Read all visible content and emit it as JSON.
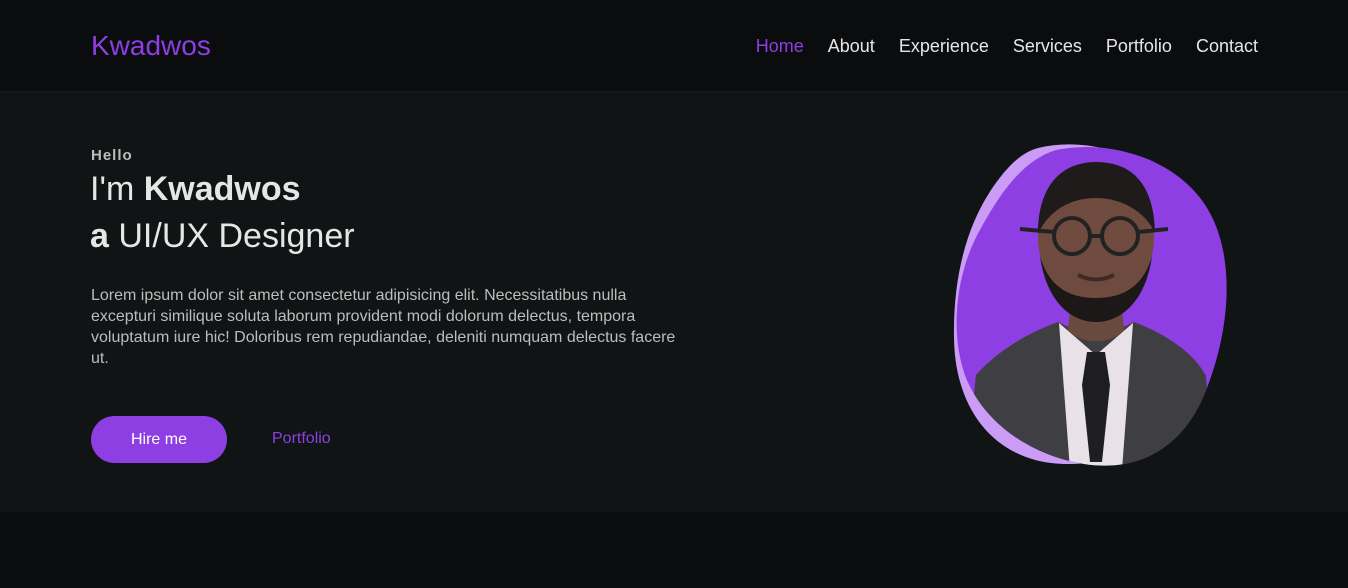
{
  "brand": {
    "name": "Kwadwos",
    "accent_color": "#8d3fe3"
  },
  "nav": {
    "items": [
      {
        "label": "Home",
        "active": true
      },
      {
        "label": "About",
        "active": false
      },
      {
        "label": "Experience",
        "active": false
      },
      {
        "label": "Services",
        "active": false
      },
      {
        "label": "Portfolio",
        "active": false
      },
      {
        "label": "Contact",
        "active": false
      }
    ]
  },
  "hero": {
    "greeting": "Hello",
    "intro_prefix": "I'm ",
    "name": "Kwadwos",
    "role_prefix": "a",
    "role": " UI/UX Designer",
    "description": "Lorem ipsum dolor sit amet consectetur adipisicing elit. Necessitatibus nulla excepturi similique soluta laborum provident modi dolorum delectus, tempora voluptatum iure hic! Doloribus rem repudiandae, deleniti numquam delectus facere ut.",
    "primary_button": "Hire me",
    "secondary_link": "Portfolio"
  }
}
